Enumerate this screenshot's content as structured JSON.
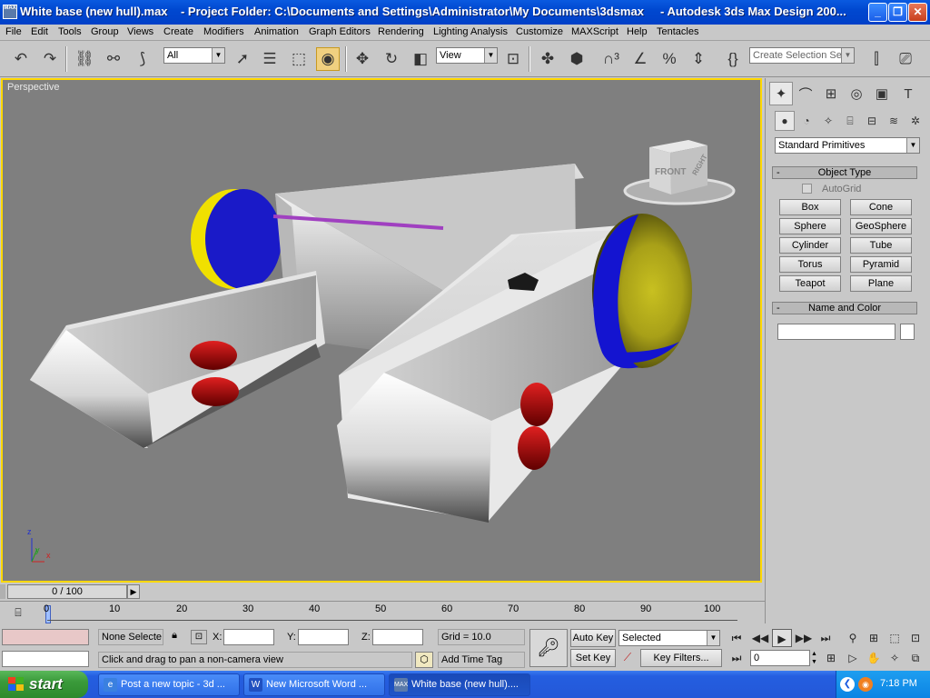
{
  "window": {
    "title": "White base (new hull).max    - Project Folder: C:\\Documents and Settings\\Administrator\\My Documents\\3dsmax     - Autodesk 3ds Max Design 200...",
    "app_icon_text": "MAX"
  },
  "menu": [
    "File",
    "Edit",
    "Tools",
    "Group",
    "Views",
    "Create",
    "Modifiers",
    "Animation",
    "Graph Editors",
    "Rendering",
    "Lighting Analysis",
    "Customize",
    "MAXScript",
    "Help",
    "Tentacles"
  ],
  "toolbar": {
    "selection_filter": "All",
    "reference_coord": "View",
    "named_selection_placeholder": "Create Selection Set"
  },
  "viewport": {
    "label": "Perspective",
    "viewcube_front": "FRONT",
    "viewcube_right": "RIGHT",
    "axes": {
      "x": "x",
      "y": "y",
      "z": "z"
    }
  },
  "command_panel": {
    "category": "Standard Primitives",
    "object_type_title": "Object Type",
    "autogrid_label": "AutoGrid",
    "primitives": [
      "Box",
      "Cone",
      "Sphere",
      "GeoSphere",
      "Cylinder",
      "Tube",
      "Torus",
      "Pyramid",
      "Teapot",
      "Plane"
    ],
    "name_color_title": "Name and Color",
    "name_value": ""
  },
  "timeline": {
    "frame_display": "0 / 100",
    "ticks": [
      "0",
      "10",
      "20",
      "30",
      "40",
      "50",
      "60",
      "70",
      "80",
      "90",
      "100"
    ]
  },
  "status": {
    "selection": "None Selecte",
    "x_label": "X:",
    "y_label": "Y:",
    "z_label": "Z:",
    "x_value": "",
    "y_value": "",
    "z_value": "",
    "grid": "Grid = 10.0",
    "prompt": "Click and drag to pan a non-camera view",
    "add_time_tag": "Add Time Tag",
    "auto_key": "Auto Key",
    "set_key": "Set Key",
    "key_mode": "Selected",
    "key_filters": "Key Filters...",
    "current_frame": "0"
  },
  "taskbar": {
    "start": "start",
    "tasks": [
      "Post a new topic - 3d ...",
      "New Microsoft Word ...",
      "White base (new hull)...."
    ],
    "clock": "7:18 PM"
  },
  "colors": {
    "viewport_bg": "#7f7f7f",
    "viewport_border": "#ffd800",
    "xp_blue": "#245ee0"
  }
}
